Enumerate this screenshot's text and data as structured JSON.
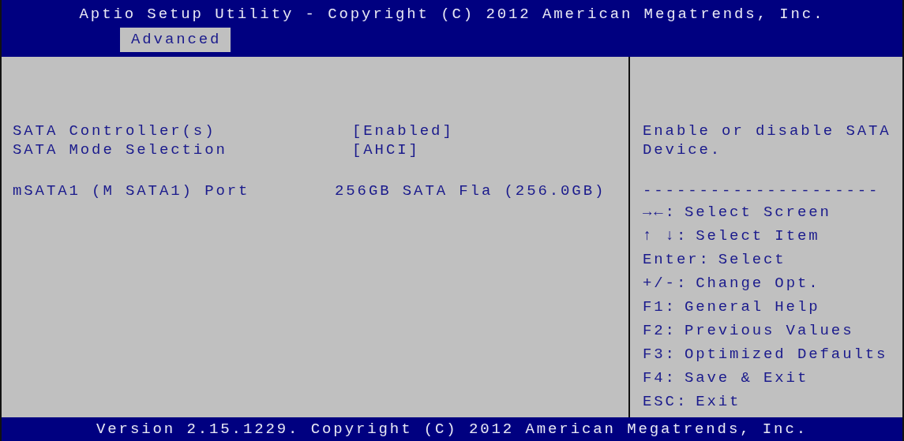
{
  "title": "Aptio Setup Utility - Copyright (C) 2012 American Megatrends, Inc.",
  "tabs": [
    {
      "label": "Advanced",
      "selected": true
    }
  ],
  "settings": [
    {
      "kind": "option",
      "label": "SATA Controller(s)",
      "value": "[Enabled]"
    },
    {
      "kind": "option",
      "label": "SATA Mode Selection",
      "value": "[AHCI]"
    },
    {
      "kind": "gap"
    },
    {
      "kind": "info",
      "label": "mSATA1 (M SATA1) Port",
      "value": "256GB SATA Fla (256.0GB)"
    }
  ],
  "help": {
    "text": "Enable or disable SATA Device.",
    "separator": "---------------------",
    "keys": [
      {
        "key": "→←:",
        "action": "Select Screen"
      },
      {
        "key": "↑ ↓:",
        "action": "Select Item"
      },
      {
        "key": "Enter:",
        "action": "Select"
      },
      {
        "key": "+/-:",
        "action": "Change Opt."
      },
      {
        "key": "F1:",
        "action": "General Help"
      },
      {
        "key": "F2:",
        "action": "Previous Values"
      },
      {
        "key": "F3:",
        "action": "Optimized Defaults"
      },
      {
        "key": "F4:",
        "action": "Save & Exit"
      },
      {
        "key": "ESC:",
        "action": "Exit"
      }
    ]
  },
  "footer": "Version 2.15.1229. Copyright (C) 2012 American Megatrends, Inc."
}
